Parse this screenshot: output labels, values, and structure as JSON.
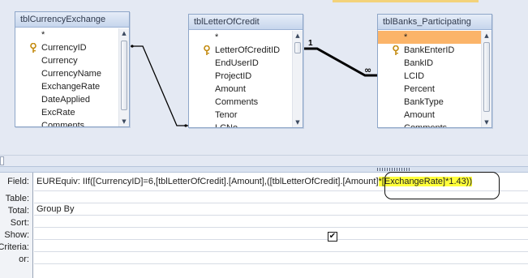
{
  "tables": [
    {
      "title": "tblCurrencyExchange",
      "fields": [
        {
          "name": "*",
          "key": false,
          "selected": false
        },
        {
          "name": "CurrencyID",
          "key": true,
          "selected": false
        },
        {
          "name": "Currency",
          "key": false,
          "selected": false
        },
        {
          "name": "CurrencyName",
          "key": false,
          "selected": false
        },
        {
          "name": "ExchangeRate",
          "key": false,
          "selected": false
        },
        {
          "name": "DateApplied",
          "key": false,
          "selected": false
        },
        {
          "name": "ExcRate",
          "key": false,
          "selected": false
        },
        {
          "name": "Comments",
          "key": false,
          "selected": false
        }
      ]
    },
    {
      "title": "tblLetterOfCredit",
      "fields": [
        {
          "name": "*",
          "key": false,
          "selected": false
        },
        {
          "name": "LetterOfCreditID",
          "key": true,
          "selected": false
        },
        {
          "name": "EndUserID",
          "key": false,
          "selected": false
        },
        {
          "name": "ProjectID",
          "key": false,
          "selected": false
        },
        {
          "name": "Amount",
          "key": false,
          "selected": false
        },
        {
          "name": "Comments",
          "key": false,
          "selected": false
        },
        {
          "name": "Tenor",
          "key": false,
          "selected": false
        },
        {
          "name": "LCNo",
          "key": false,
          "selected": false
        }
      ]
    },
    {
      "title": "tblBanks_Participating",
      "fields": [
        {
          "name": "*",
          "key": false,
          "selected": true
        },
        {
          "name": "BankEnterID",
          "key": true,
          "selected": false
        },
        {
          "name": "BankID",
          "key": false,
          "selected": false
        },
        {
          "name": "LCID",
          "key": false,
          "selected": false
        },
        {
          "name": "Percent",
          "key": false,
          "selected": false
        },
        {
          "name": "BankType",
          "key": false,
          "selected": false
        },
        {
          "name": "Amount",
          "key": false,
          "selected": false
        },
        {
          "name": "Comments",
          "key": false,
          "selected": false
        }
      ]
    }
  ],
  "relationships": [
    {
      "from": "tblLetterOfCredit",
      "to": "tblBanks_Participating",
      "one_label": "1",
      "many_label": "∞"
    }
  ],
  "grid": {
    "row_labels": [
      "Field:",
      "Table:",
      "Total:",
      "Sort:",
      "Show:",
      "Criteria:",
      "or:"
    ],
    "field_expression_before": "EUREquiv: IIf([CurrencyID]=6,[tblLetterOfCredit].[Amount],([tblLetterOfCredit].[Amount]",
    "field_expression_highlight": "*[ExchangeRate]*1.43))",
    "table": "",
    "total": "Group By",
    "sort": "",
    "show": true,
    "show_mark": "✔",
    "criteria": "",
    "or": ""
  },
  "icons": {
    "key": "primary-key-icon",
    "scroll_up": "▲",
    "scroll_down": "▼"
  },
  "colors": {
    "selected_field": "#fbb469",
    "highlight": "#ffff3a",
    "canvas": "#e4e9f3"
  }
}
